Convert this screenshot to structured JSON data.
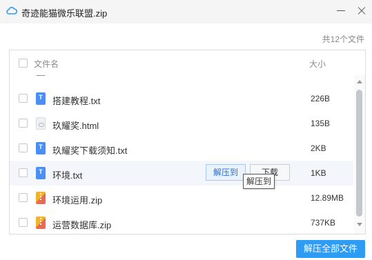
{
  "window": {
    "title": "奇迹能猫微乐联盟.zip",
    "app_icon": "cloud-icon",
    "minimize_icon": "minimize-icon",
    "close_icon": "close-icon"
  },
  "summary": {
    "file_count_text": "共12个文件"
  },
  "list": {
    "header": {
      "name_label": "文件名",
      "size_label": "大小"
    },
    "rows": [
      {
        "name": "",
        "size": "",
        "icon": "zip-file-icon"
      },
      {
        "name": "搭建教程.txt",
        "size": "226B",
        "icon": "txt-file-icon"
      },
      {
        "name": "玖耀奖.html",
        "size": "135B",
        "icon": "html-file-icon"
      },
      {
        "name": "玖耀奖下载须知.txt",
        "size": "2KB",
        "icon": "txt-file-icon"
      },
      {
        "name": "环境.txt",
        "size": "1KB",
        "icon": "txt-file-icon"
      },
      {
        "name": "环境运用.zip",
        "size": "12.89MB",
        "icon": "zip-file-icon"
      },
      {
        "name": "运营数据库.zip",
        "size": "737KB",
        "icon": "zip-file-icon"
      }
    ],
    "hover_row_actions": {
      "extract_to_label": "解压到",
      "download_label": "下载"
    },
    "tooltip": "解压到"
  },
  "footer": {
    "extract_all_label": "解压全部文件"
  },
  "colors": {
    "accent": "#2f9cf4",
    "txt_icon": "#4a8ff6",
    "zip_icon_top": "#f3b32b",
    "zip_icon_bottom": "#e86a57"
  }
}
